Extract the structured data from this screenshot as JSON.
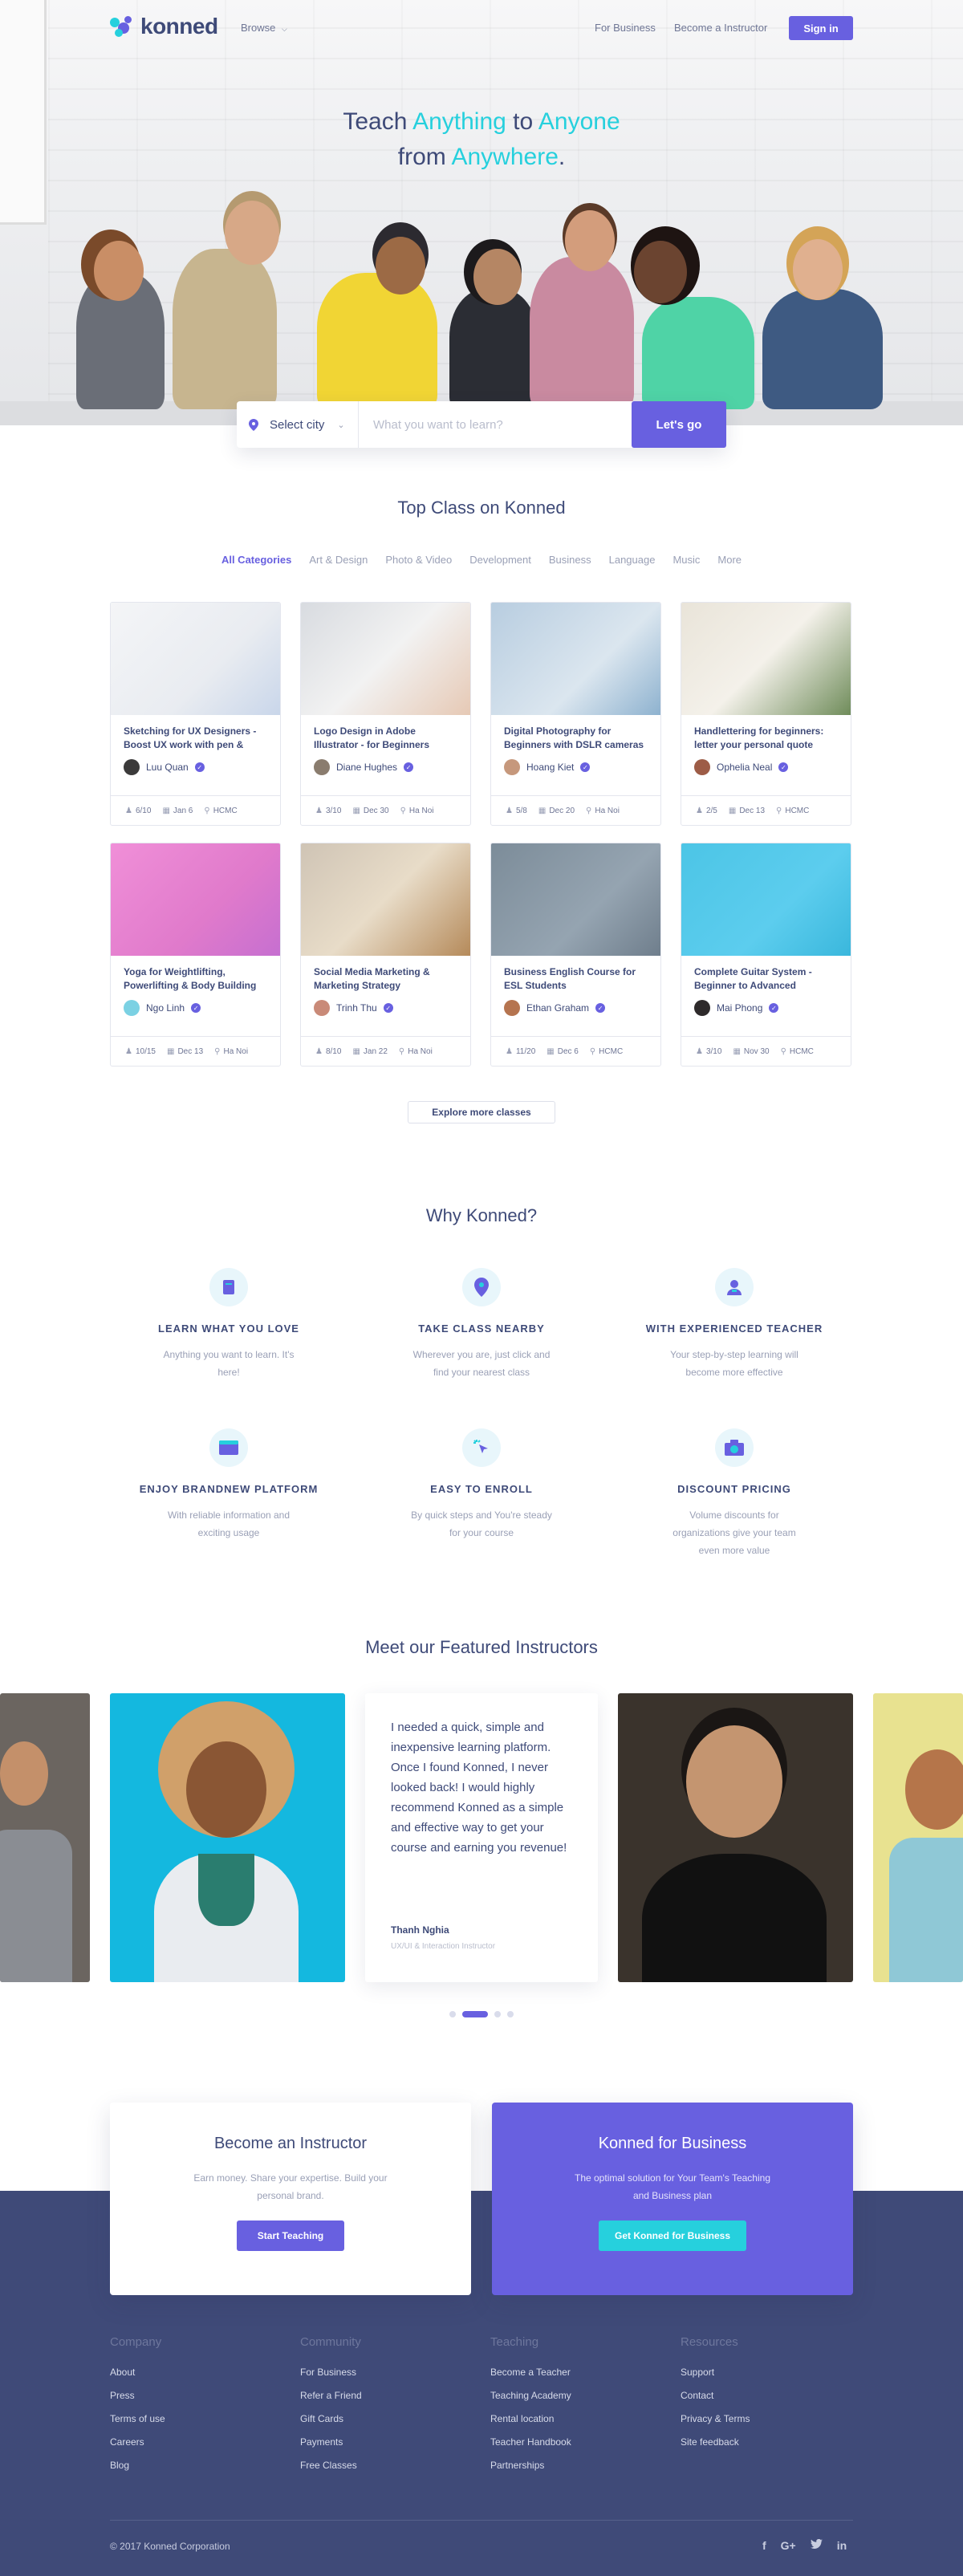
{
  "brand": {
    "name": "konned",
    "primary": "#6860e0",
    "accent": "#26d0dd",
    "navy": "#3f4a78"
  },
  "nav": {
    "browse": "Browse",
    "for_business": "For Business",
    "become_instructor": "Become a Instructor",
    "sign_in": "Sign in"
  },
  "hero": {
    "t1": "Teach ",
    "t2": "Anything",
    "t3": " to ",
    "t4": "Anyone",
    "t5": "from ",
    "t6": "Anywhere",
    "t7": "."
  },
  "search": {
    "city": "Select city",
    "placeholder": "What you want to learn?",
    "button": "Let's go"
  },
  "top_class": {
    "title": "Top Class on Konned",
    "categories": [
      "All Categories",
      "Art & Design",
      "Photo & Video",
      "Development",
      "Business",
      "Language",
      "Music",
      "More"
    ],
    "cards": [
      {
        "title": "Sketching for UX Designers - Boost UX work with pen & paper",
        "author": "Luu Quan",
        "seats": "6/10",
        "date": "Jan 6",
        "city": "HCMC"
      },
      {
        "title": "Logo Design in Adobe Illustrator - for Beginners",
        "author": "Diane Hughes",
        "seats": "3/10",
        "date": "Dec 30",
        "city": "Ha Noi"
      },
      {
        "title": "Digital Photography for Beginners with DSLR cameras",
        "author": "Hoang Kiet",
        "seats": "5/8",
        "date": "Dec 20",
        "city": "Ha Noi"
      },
      {
        "title": "Handlettering for beginners: letter your personal quote",
        "author": "Ophelia Neal",
        "seats": "2/5",
        "date": "Dec 13",
        "city": "HCMC"
      },
      {
        "title": "Yoga for Weightlifting, Powerlifting & Body Building",
        "author": "Ngo Linh",
        "seats": "10/15",
        "date": "Dec 13",
        "city": "Ha Noi"
      },
      {
        "title": "Social Media Marketing & Marketing Strategy Mastercourse",
        "author": "Trinh Thu",
        "seats": "8/10",
        "date": "Jan 22",
        "city": "Ha Noi"
      },
      {
        "title": "Business English Course for ESL Students",
        "author": "Ethan Graham",
        "seats": "11/20",
        "date": "Dec 6",
        "city": "HCMC"
      },
      {
        "title": "Complete Guitar System - Beginner to Advanced",
        "author": "Mai Phong",
        "seats": "3/10",
        "date": "Nov 30",
        "city": "HCMC"
      }
    ],
    "explore": "Explore more classes"
  },
  "why": {
    "title": "Why Konned?",
    "items": [
      {
        "title": "LEARN WHAT YOU LOVE",
        "desc": "Anything you want to learn. It's here!"
      },
      {
        "title": "TAKE CLASS NEARBY",
        "desc": "Wherever you are, just click and find your nearest class"
      },
      {
        "title": "WITH EXPERIENCED TEACHER",
        "desc": "Your step-by-step learning will become more effective"
      },
      {
        "title": "ENJOY BRANDNEW PLATFORM",
        "desc": "With reliable information and exciting usage"
      },
      {
        "title": "EASY TO ENROLL",
        "desc": "By quick steps and You're steady for your course"
      },
      {
        "title": "DISCOUNT PRICING",
        "desc": "Volume discounts for organizations give your team even more value"
      }
    ]
  },
  "instructors": {
    "title": "Meet our Featured Instructors",
    "quote": "I needed a quick, simple and inexpensive learning platform. Once I found Konned, I never looked back! I would highly recommend Konned as a simple and effective way to get your course and earning you revenue!",
    "name": "Thanh Nghia",
    "role": "UX/UI & Interaction Instructor"
  },
  "cta": {
    "instructor_title": "Become an Instructor",
    "instructor_desc": "Earn money. Share your expertise. Build your personal brand.",
    "instructor_btn": "Start Teaching",
    "business_title": "Konned for Business",
    "business_desc": "The optimal solution for Your Team's Teaching and Business plan",
    "business_btn": "Get Konned for Business"
  },
  "footer": {
    "columns": [
      {
        "heading": "Company",
        "links": [
          "About",
          "Press",
          "Terms of use",
          "Careers",
          "Blog"
        ]
      },
      {
        "heading": "Community",
        "links": [
          "For Business",
          "Refer a Friend",
          "Gift Cards",
          "Payments",
          "Free Classes"
        ]
      },
      {
        "heading": "Teaching",
        "links": [
          "Become a Teacher",
          "Teaching Academy",
          "Rental location",
          "Teacher Handbook",
          "Partnerships"
        ]
      },
      {
        "heading": "Resources",
        "links": [
          "Support",
          "Contact",
          "Privacy & Terms",
          "Site feedback"
        ]
      }
    ],
    "copyright": "© 2017 Konned Corporation",
    "social": {
      "facebook": "f",
      "google": "G+",
      "twitter": "t",
      "linkedin": "in"
    }
  }
}
